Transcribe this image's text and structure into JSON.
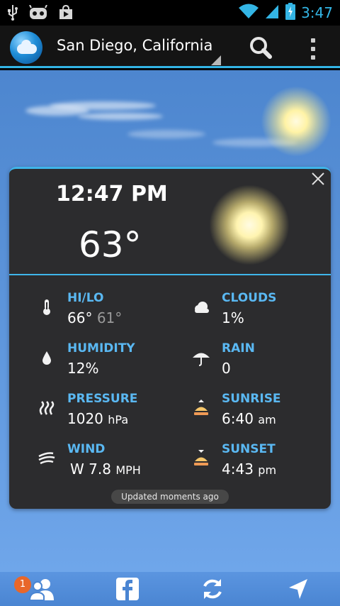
{
  "status_bar": {
    "time": "3:47",
    "icons": [
      "usb-icon",
      "cyanogen-android-icon",
      "play-store-icon",
      "wifi-icon",
      "signal-icon",
      "battery-charging-icon"
    ]
  },
  "action_bar": {
    "location": "San Diego, California",
    "icons": [
      "app-logo-icon",
      "dropdown-corner-icon",
      "search-icon",
      "overflow-menu-icon"
    ]
  },
  "card": {
    "time": "12:47 PM",
    "temperature": "63°",
    "details": [
      {
        "label": "HI/LO",
        "value": "66°",
        "value2": "61°",
        "icon": "thermometer-icon"
      },
      {
        "label": "CLOUDS",
        "value": "1%",
        "icon": "cloud-icon"
      },
      {
        "label": "HUMIDITY",
        "value": "12%",
        "icon": "raindrop-icon"
      },
      {
        "label": "RAIN",
        "value": "0",
        "icon": "umbrella-icon"
      },
      {
        "label": "PRESSURE",
        "value": "1020",
        "unit": "hPa",
        "icon": "pressure-icon"
      },
      {
        "label": "SUNRISE",
        "value": "6:40",
        "unit": "am",
        "icon": "sunrise-icon"
      },
      {
        "label": "WIND",
        "value": "W 7.8",
        "unit": "MPH",
        "icon": "wind-icon"
      },
      {
        "label": "SUNSET",
        "value": "4:43",
        "unit": "pm",
        "icon": "sunset-icon"
      }
    ],
    "updated": "Updated moments ago"
  },
  "bottom_bar": {
    "badge": "1",
    "icons": [
      "friends-icon",
      "facebook-icon",
      "refresh-icon",
      "location-arrow-icon"
    ]
  },
  "colors": {
    "accent": "#33b5e5",
    "label_blue": "#5ab8f2",
    "card_bg": "#2c2c2e",
    "sky": "#5a92d8",
    "badge": "#e8672a"
  }
}
